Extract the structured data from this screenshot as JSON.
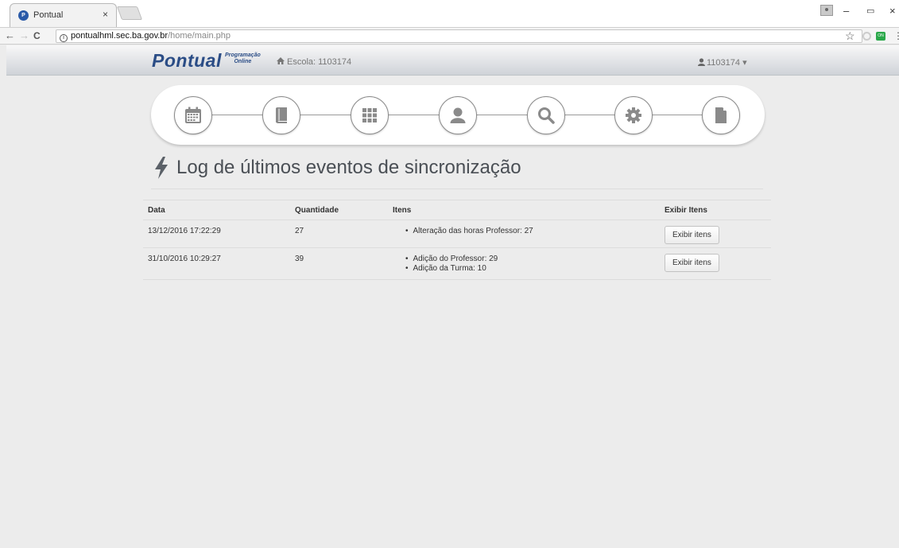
{
  "browser": {
    "tab_title": "Pontual",
    "tab_close": "×",
    "url_domain": "pontualhml.sec.ba.gov.br",
    "url_path": "/home/main.php",
    "info_glyph": "i",
    "controls": {
      "minimize": "–",
      "restore": "▭",
      "close": "×"
    },
    "nav": {
      "back": "←",
      "forward": "→",
      "reload": "C"
    },
    "star": "☆",
    "menu": "⋮"
  },
  "app": {
    "brand": "Pontual",
    "brand_sub_line1": "Programação",
    "brand_sub_line2": "Online",
    "school_label": "Escola: 1103174",
    "user_label": "1103174",
    "user_caret": "▾",
    "nav_icons": [
      "calendar-icon",
      "book-icon",
      "grid-icon",
      "user-icon",
      "search-icon",
      "gear-icon",
      "document-icon"
    ]
  },
  "log": {
    "heading": "Log de últimos eventos de sincronização",
    "columns": {
      "date": "Data",
      "quantity": "Quantidade",
      "items": "Itens",
      "show": "Exibir Itens"
    },
    "rows": [
      {
        "date": "13/12/2016 17:22:29",
        "quantity": "27",
        "items": [
          "Alteração das horas Professor: 27"
        ],
        "button": "Exibir itens"
      },
      {
        "date": "31/10/2016 10:29:27",
        "quantity": "39",
        "items": [
          "Adição do Professor: 29",
          "Adição da Turma: 10"
        ],
        "button": "Exibir itens"
      }
    ]
  },
  "colors": {
    "brand": "#2b4d86",
    "page_bg": "#ececec",
    "navbar_bottom": "#cfd3d8"
  }
}
